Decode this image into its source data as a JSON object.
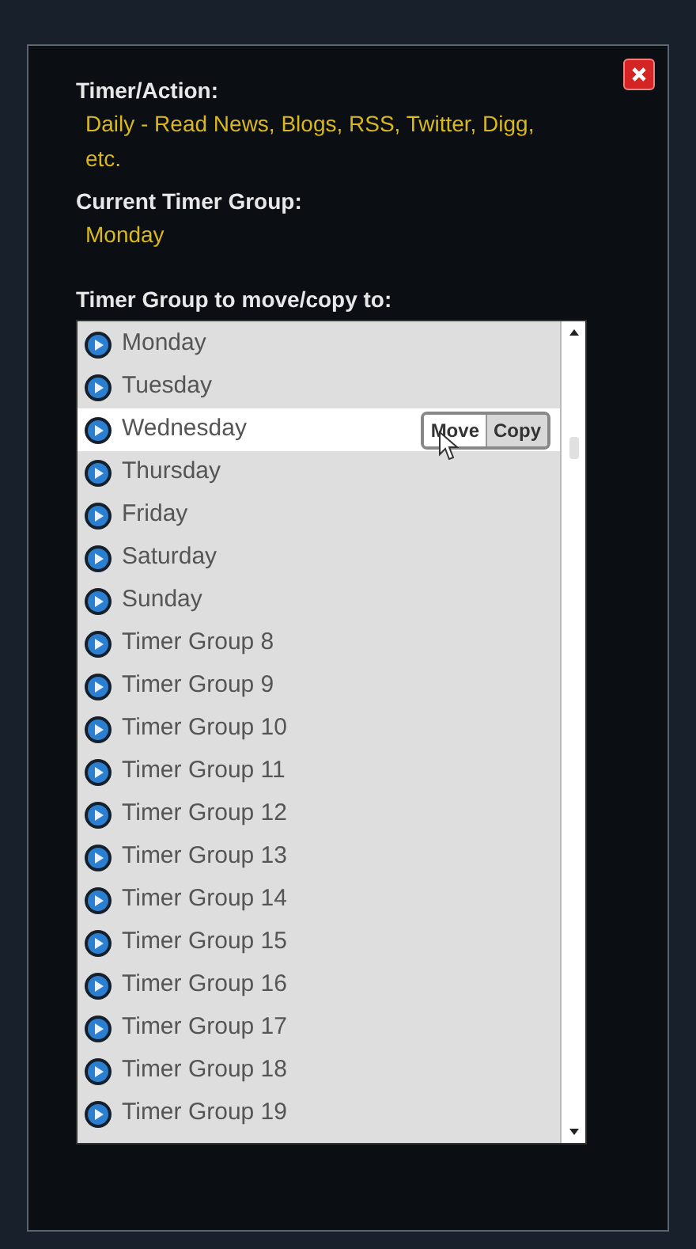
{
  "dialog": {
    "sections": [
      {
        "label": "Timer/Action:",
        "value": "Daily - Read News, Blogs, RSS, Twitter, Digg, etc."
      },
      {
        "label": "Current Timer Group:",
        "value": "Monday"
      }
    ],
    "list_label": "Timer Group to move/copy to:",
    "groups": [
      {
        "name": "Monday",
        "selected": false
      },
      {
        "name": "Tuesday",
        "selected": false
      },
      {
        "name": "Wednesday",
        "selected": true
      },
      {
        "name": "Thursday",
        "selected": false
      },
      {
        "name": "Friday",
        "selected": false
      },
      {
        "name": "Saturday",
        "selected": false
      },
      {
        "name": "Sunday",
        "selected": false
      },
      {
        "name": "Timer Group 8",
        "selected": false
      },
      {
        "name": "Timer Group 9",
        "selected": false
      },
      {
        "name": "Timer Group 10",
        "selected": false
      },
      {
        "name": "Timer Group 11",
        "selected": false
      },
      {
        "name": "Timer Group 12",
        "selected": false
      },
      {
        "name": "Timer Group 13",
        "selected": false
      },
      {
        "name": "Timer Group 14",
        "selected": false
      },
      {
        "name": "Timer Group 15",
        "selected": false
      },
      {
        "name": "Timer Group 16",
        "selected": false
      },
      {
        "name": "Timer Group 17",
        "selected": false
      },
      {
        "name": "Timer Group 18",
        "selected": false
      },
      {
        "name": "Timer Group 19",
        "selected": false
      }
    ],
    "actions": [
      "Move",
      "Copy"
    ]
  }
}
